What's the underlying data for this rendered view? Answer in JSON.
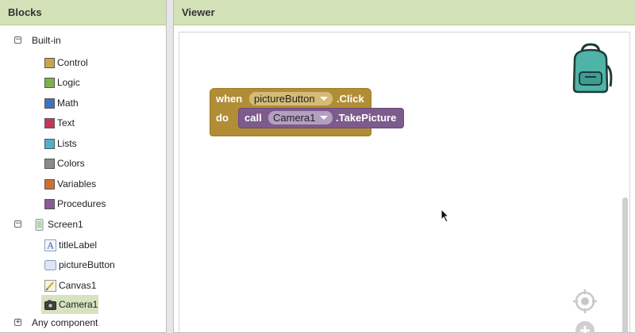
{
  "blocks_panel": {
    "title": "Blocks",
    "builtin": {
      "label": "Built-in",
      "toggle": "−",
      "items": [
        {
          "label": "Control",
          "color": "#c8a64a"
        },
        {
          "label": "Logic",
          "color": "#7fb04a"
        },
        {
          "label": "Math",
          "color": "#3d74bf"
        },
        {
          "label": "Text",
          "color": "#c5375a"
        },
        {
          "label": "Lists",
          "color": "#4fb0cf"
        },
        {
          "label": "Colors",
          "color": "#8b8b8b"
        },
        {
          "label": "Variables",
          "color": "#d07030"
        },
        {
          "label": "Procedures",
          "color": "#8a5b96"
        }
      ]
    },
    "screen": {
      "label": "Screen1",
      "toggle": "−",
      "components": [
        {
          "label": "titleLabel",
          "icon": "label-icon"
        },
        {
          "label": "pictureButton",
          "icon": "button-icon"
        },
        {
          "label": "Canvas1",
          "icon": "canvas-icon"
        },
        {
          "label": "Camera1",
          "icon": "camera-icon",
          "selected": true
        }
      ]
    },
    "any_component": {
      "label": "Any component",
      "toggle": "+"
    }
  },
  "viewer": {
    "title": "Viewer",
    "event_block": {
      "when": "when",
      "component": "pictureButton",
      "event": ".Click",
      "do": "do"
    },
    "call_block": {
      "call": "call",
      "component": "Camera1",
      "method": ".TakePicture"
    },
    "icons": [
      "backpack-icon",
      "center-target-icon",
      "zoom-in-icon"
    ]
  },
  "colors": {
    "header_bg": "#d3e1b8",
    "event_block": "#b18e35",
    "call_block": "#7d5b8c"
  }
}
